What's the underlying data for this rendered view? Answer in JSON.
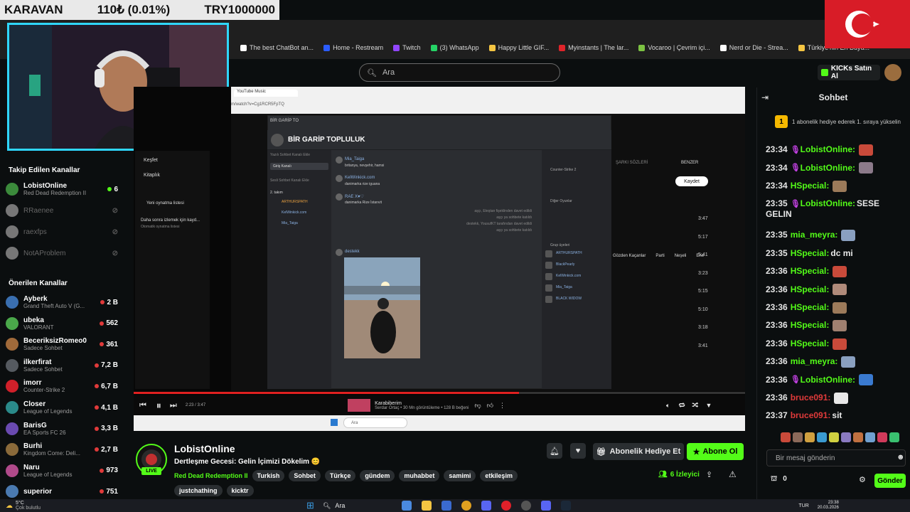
{
  "overlay": {
    "ticker_left": "KARAVAN",
    "ticker_mid": "110₺ (0.01%)",
    "ticker_right": "TRY1000000"
  },
  "bookmarks": [
    {
      "label": "The best ChatBot an...",
      "color": "#ffffff"
    },
    {
      "label": "Home - Restream",
      "color": "#2b5cff"
    },
    {
      "label": "Twitch",
      "color": "#9146ff"
    },
    {
      "label": "(3) WhatsApp",
      "color": "#25d366"
    },
    {
      "label": "Happy Little GIF...",
      "color": "#f4c542"
    },
    {
      "label": "Myinstants | The lar...",
      "color": "#e0242a"
    },
    {
      "label": "Vocaroo | Çevrim içi...",
      "color": "#7cc242"
    },
    {
      "label": "Nerd or Die - Strea...",
      "color": "#ffffff"
    },
    {
      "label": "Türkiye'nin En Büyü...",
      "color": "#f4c542"
    }
  ],
  "header": {
    "search_placeholder": "Ara",
    "buy_kicks": "KICKs Satın Al"
  },
  "sidebar": {
    "followed_title": "Takip Edilen Kanallar",
    "followed": [
      {
        "name": "LobistOnline",
        "game": "Red Dead Redemption II",
        "viewers": "6",
        "online": true,
        "color": "#3b8a3b"
      },
      {
        "name": "RRaenee",
        "game": "",
        "viewers": "",
        "online": false,
        "color": "#777777"
      },
      {
        "name": "raexfps",
        "game": "",
        "viewers": "",
        "online": false,
        "color": "#777777"
      },
      {
        "name": "NotAProblem",
        "game": "",
        "viewers": "",
        "online": false,
        "color": "#777777"
      }
    ],
    "recommended_title": "Önerilen Kanallar",
    "recommended": [
      {
        "name": "Ayberk",
        "game": "Grand Theft Auto V (G...",
        "viewers": "2 B",
        "color": "#3a6fb0"
      },
      {
        "name": "ubeka",
        "game": "VALORANT",
        "viewers": "562",
        "color": "#4aa84a"
      },
      {
        "name": "BeceriksizRomeo0",
        "game": "Sadece Sohbet",
        "viewers": "361",
        "color": "#a06a3a"
      },
      {
        "name": "ilkerfirat",
        "game": "Sadece Sohbet",
        "viewers": "7,2 B",
        "color": "#555a60"
      },
      {
        "name": "imorr",
        "game": "Counter-Strike 2",
        "viewers": "6,7 B",
        "color": "#d0202a"
      },
      {
        "name": "Closer",
        "game": "League of Legends",
        "viewers": "4,1 B",
        "color": "#2a8a8a"
      },
      {
        "name": "BarisG",
        "game": "EA Sports FC 26",
        "viewers": "3,3 B",
        "color": "#6a4ab0"
      },
      {
        "name": "Burhi",
        "game": "Kingdom Come: Deli...",
        "viewers": "2,7 B",
        "color": "#8a6a3a"
      },
      {
        "name": "Naru",
        "game": "League of Legends",
        "viewers": "973",
        "color": "#b04a8a"
      },
      {
        "name": "superior",
        "game": "",
        "viewers": "751",
        "color": "#4a7ab0"
      }
    ]
  },
  "screen": {
    "yt_tab": "YouTube Music",
    "yt_url": "m/watch?v=Cg1RCR5FpTQ",
    "yt_menu": [
      "Keşfet",
      "Kitaplık",
      "Yeni oynatma listesi"
    ],
    "yt_note": "Daha sonra izlemek için kayd...",
    "yt_note_sub": "Otomatik oynatma listesi",
    "save_label": "Kaydet",
    "tab_lyrics": "ŞARKI SÖZLERİ",
    "tab_related": "BENZER",
    "chips": [
      "Gözden Kaçanlar",
      "Parti",
      "Neşeli",
      "Ene"
    ],
    "durations": [
      "3:47",
      "5:17",
      "5:41",
      "3:23",
      "5:15",
      "5:10",
      "3:18",
      "3:41"
    ],
    "discord": {
      "server": "BİR GARİP TOPLULUK",
      "tab": "BİR GARİP TO",
      "channels": [
        "Yazılı Sohbet Kanalı Ekle",
        "Giriş Kanalı",
        "Sesli Sohbet Kanalı Ekle",
        "2. takım"
      ],
      "voice_users": [
        "ARTHURSPATH",
        "KelWinkick.com",
        "Mia_Taiga"
      ],
      "messages": [
        {
          "user": "Mia_Taiga",
          "text": "britanya, nevşehir, hamsi"
        },
        {
          "user": "KelWinkick.com",
          "text": "danimarka rize iguana"
        },
        {
          "user": "RAE X♥♡",
          "text": "danimarka Rize İstanvit"
        },
        {
          "user": "destekk",
          "text": ""
        }
      ],
      "system": [
        "aşçı, Eteştan fişeklinden davet edildi",
        "aşçı ya sohbete katıldı",
        "destekk, YousufKT tarafından davet edildi",
        "aşçı ya sohbete katıldı"
      ],
      "member_groups": [
        "Counter-Strike 2",
        "Diğer Oyunlar",
        "Grup üyeleri"
      ],
      "members": [
        "ARTHURSPATH",
        "BlackPearly",
        "KelWinkick.com",
        "Mia_Taiga",
        "BLACK WIDOW"
      ]
    },
    "np_title": "Karabiberim",
    "np_sub": "Serdar Ortaç • 30 Mn görüntüleme • 128 B beğeni",
    "time": "2:23 / 3:47",
    "win_search": "Ara"
  },
  "stream": {
    "name": "LobistOnline",
    "live": "LIVE",
    "title": "Dertleşme Gecesi: Gelin İçimizi Dökelim 😊",
    "category": "Red Dead Redemption II",
    "tags": [
      "Turkish",
      "Sohbet",
      "Türkçe",
      "gündem",
      "muhabbet",
      "samimi",
      "etkileşim"
    ],
    "tags2": [
      "justchathing",
      "kicktr"
    ],
    "gift_label": "Abonelik Hediye Et",
    "follow_label": "Abone Ol",
    "viewers": "6 İzleyici"
  },
  "chat": {
    "title": "Sohbet",
    "gift_rank": "1",
    "gift_note": "1 abonelik hediye ederek 1. sıraya yükselin",
    "messages": [
      {
        "ts": "23:34",
        "user": "LobistOnline:",
        "text": "",
        "ucolor": "#53fc18",
        "emote": "#c94a3a",
        "badge": true
      },
      {
        "ts": "23:34",
        "user": "LobistOnline:",
        "text": "",
        "ucolor": "#53fc18",
        "emote": "#8c7a8a",
        "badge": true
      },
      {
        "ts": "23:34",
        "user": "HSpecial:",
        "text": "",
        "ucolor": "#53fc18",
        "emote": "#9c7a5a",
        "badge": false
      },
      {
        "ts": "23:35",
        "user": "LobistOnline:",
        "text": "SESE GELIN",
        "ucolor": "#53fc18",
        "emote": "",
        "badge": true
      },
      {
        "ts": "23:35",
        "user": "mia_meyra:",
        "text": "",
        "ucolor": "#53fc18",
        "emote": "#8aa0c0",
        "badge": false
      },
      {
        "ts": "23:35",
        "user": "HSpecial:",
        "text": "dc mi",
        "ucolor": "#53fc18",
        "emote": "",
        "badge": false
      },
      {
        "ts": "23:36",
        "user": "HSpecial:",
        "text": "",
        "ucolor": "#53fc18",
        "emote": "#c94a3a",
        "badge": false
      },
      {
        "ts": "23:36",
        "user": "HSpecial:",
        "text": "",
        "ucolor": "#53fc18",
        "emote": "#b08a7a",
        "badge": false
      },
      {
        "ts": "23:36",
        "user": "HSpecial:",
        "text": "",
        "ucolor": "#53fc18",
        "emote": "#9c7a5a",
        "badge": false
      },
      {
        "ts": "23:36",
        "user": "HSpecial:",
        "text": "",
        "ucolor": "#53fc18",
        "emote": "#a08070",
        "badge": false
      },
      {
        "ts": "23:36",
        "user": "HSpecial:",
        "text": "",
        "ucolor": "#53fc18",
        "emote": "#c94a3a",
        "badge": false
      },
      {
        "ts": "23:36",
        "user": "mia_meyra:",
        "text": "",
        "ucolor": "#53fc18",
        "emote": "#8aa0c0",
        "badge": false
      },
      {
        "ts": "23:36",
        "user": "LobistOnline:",
        "text": "",
        "ucolor": "#53fc18",
        "emote": "#3a7ad0",
        "badge": true
      },
      {
        "ts": "23:36",
        "user": "bruce091:",
        "text": "",
        "ucolor": "#e03a3a",
        "emote": "#e8e8e8",
        "badge": false
      },
      {
        "ts": "23:37",
        "user": "bruce091:",
        "text": "sit",
        "ucolor": "#e03a3a",
        "emote": "",
        "badge": false
      }
    ],
    "emotes": [
      "#c94a3a",
      "#8c6a5a",
      "#d0a040",
      "#3a9ad0",
      "#d0d040",
      "#8a7ac0",
      "#c07040",
      "#70a0d0",
      "#d03a5a",
      "#3ac070"
    ],
    "input_placeholder": "Bir mesaj gönderin",
    "kicks_count": "0",
    "send_label": "Gönder"
  },
  "taskbar": {
    "weather_temp": "5°C",
    "weather_desc": "Çok bulutlu",
    "search": "Ara",
    "lang": "TUR",
    "time": "23:38",
    "date": "20.03.2026"
  },
  "colors": {
    "accent": "#53fc18",
    "webcam_border": "#2fd7ff",
    "flag": "#d81c27"
  }
}
